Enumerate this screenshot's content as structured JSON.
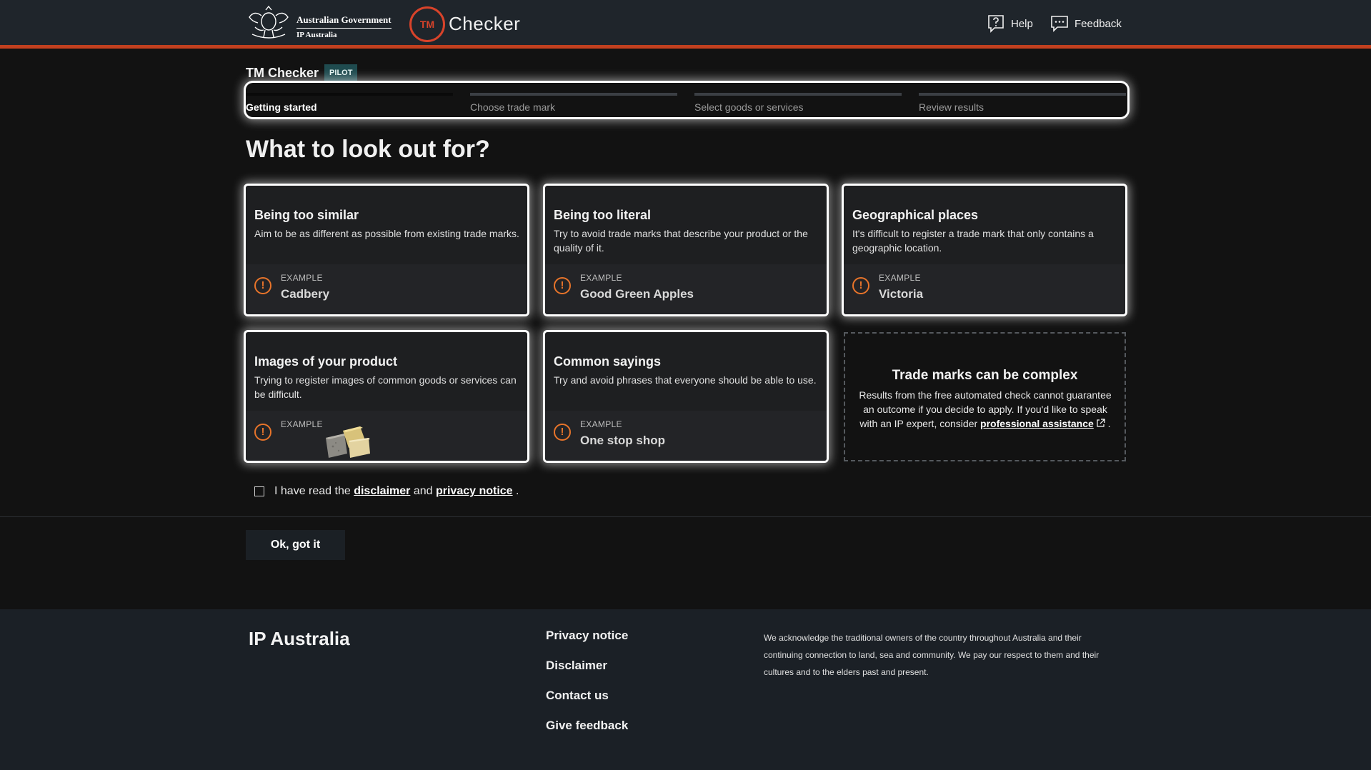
{
  "header": {
    "gov_line1": "Australian Government",
    "gov_line2": "IP Australia",
    "tm_badge": "TM",
    "app_name": "Checker",
    "help_label": "Help",
    "feedback_label": "Feedback",
    "icons": [
      "crest-logo",
      "help-icon",
      "feedback-icon"
    ],
    "accent_color": "#c2401f"
  },
  "title": {
    "text": "TM Checker",
    "badge": "PILOT"
  },
  "steps": [
    {
      "label": "Getting started",
      "active": true
    },
    {
      "label": "Choose trade mark",
      "active": false
    },
    {
      "label": "Select goods or services",
      "active": false
    },
    {
      "label": "Review results",
      "active": false
    }
  ],
  "heading": "What to look out for?",
  "cards": [
    {
      "title": "Being too similar",
      "desc": "Aim to be as different as possible from existing trade marks.",
      "example_label": "EXAMPLE",
      "example": "Cadbery"
    },
    {
      "title": "Being too literal",
      "desc": "Try to avoid trade marks that describe your product or the quality of it.",
      "example_label": "EXAMPLE",
      "example": "Good Green Apples"
    },
    {
      "title": "Geographical places",
      "desc": "It's difficult to register a trade mark that only contains a geographic location.",
      "example_label": "EXAMPLE",
      "example": "Victoria"
    },
    {
      "title": "Images of your product",
      "desc": "Trying to register images of common goods or services can be difficult.",
      "example_label": "EXAMPLE",
      "example_image": "cheese-image"
    },
    {
      "title": "Common sayings",
      "desc": "Try and avoid phrases that everyone should be able to use.",
      "example_label": "EXAMPLE",
      "example": "One stop shop"
    }
  ],
  "info": {
    "title": "Trade marks can be complex",
    "desc": "Results from the free automated check cannot guarantee an outcome if you decide to apply. If you'd like to speak with an IP expert, consider",
    "link": "professional assistance",
    "end": "."
  },
  "consent": {
    "prefix": "I have read the",
    "disclaimer": "disclaimer",
    "and": "and",
    "privacy": "privacy notice",
    "end": ".",
    "checked": false
  },
  "ok_button": "Ok, got it",
  "footer": {
    "brand": "IP Australia",
    "links": [
      "Privacy notice",
      "Disclaimer",
      "Contact us",
      "Give feedback"
    ],
    "acknowledgement": "We acknowledge the traditional owners of the country throughout Australia and their continuing connection to land, sea and community. We pay our respect to them and their cultures and to the elders past and present."
  }
}
